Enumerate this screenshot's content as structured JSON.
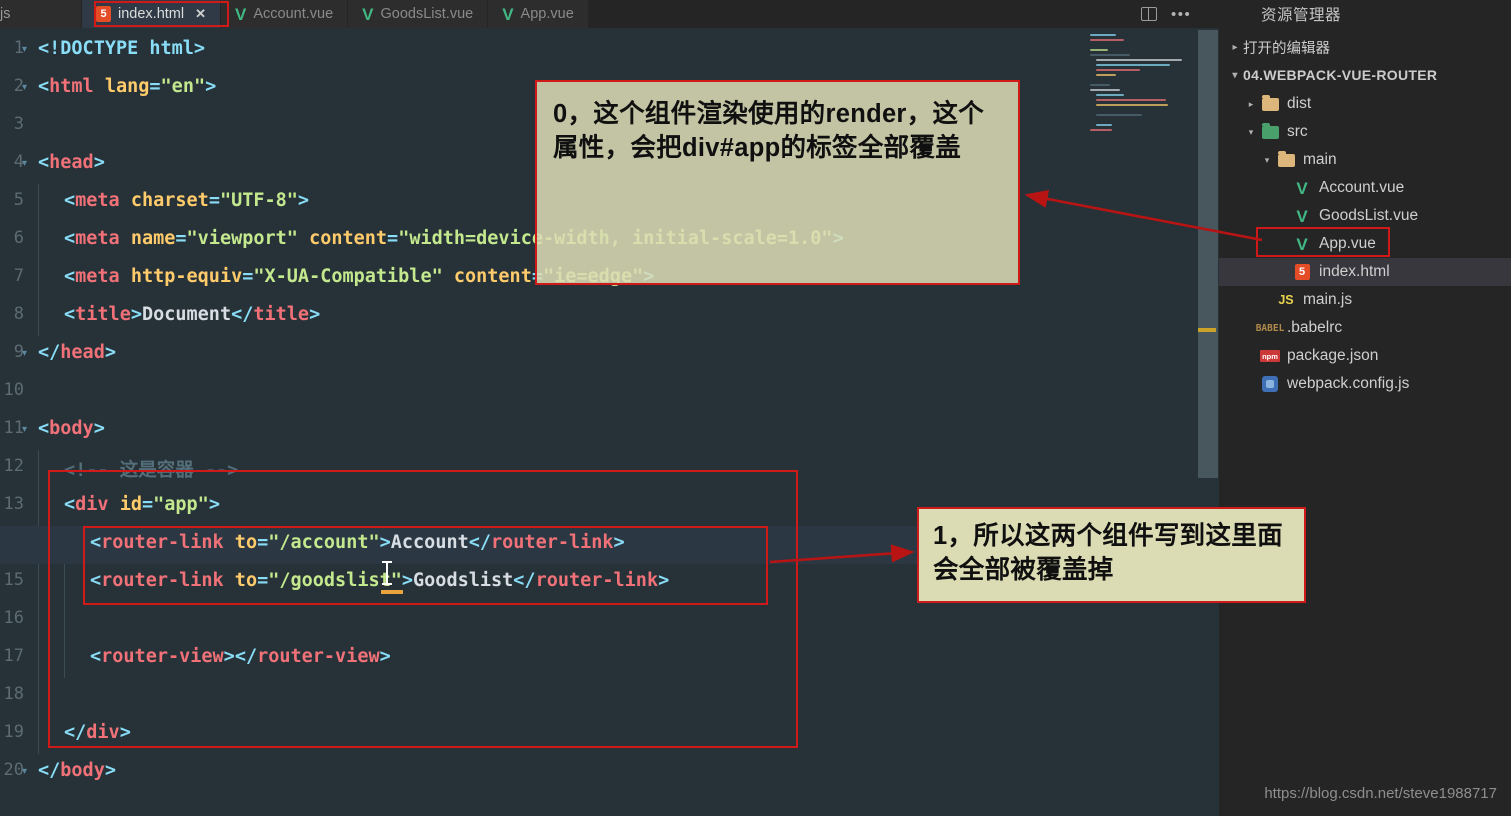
{
  "window": {
    "app": "Visual Studio Code",
    "watermark": "https://blog.csdn.net/steve1988717"
  },
  "tabbar": {
    "tabs": [
      {
        "label": ".js",
        "icon": "js-icon",
        "active": false,
        "partial": true
      },
      {
        "label": "index.html",
        "icon": "html5-icon",
        "active": true,
        "close": "✕",
        "highlighted": true
      },
      {
        "label": "Account.vue",
        "icon": "vue-icon",
        "active": false
      },
      {
        "label": "GoodsList.vue",
        "icon": "vue-icon",
        "active": false
      },
      {
        "label": "App.vue",
        "icon": "vue-icon",
        "active": false
      }
    ],
    "actions": [
      {
        "name": "split-editor-icon",
        "label": ""
      },
      {
        "name": "more-actions-icon",
        "label": "•••"
      }
    ]
  },
  "editor": {
    "file": "index.html",
    "language": "html",
    "lines": [
      {
        "n": "1",
        "fold": "▾",
        "segs": [
          {
            "t": "<!DOCTYPE html>",
            "c": "t-doctype"
          }
        ]
      },
      {
        "n": "2",
        "fold": "▾",
        "segs": [
          {
            "t": "<",
            "c": "t-punc"
          },
          {
            "t": "html",
            "c": "t-tag"
          },
          {
            "t": " lang",
            "c": "t-attr"
          },
          {
            "t": "=",
            "c": "t-punc"
          },
          {
            "t": "\"en\"",
            "c": "t-str"
          },
          {
            "t": ">",
            "c": "t-punc"
          }
        ]
      },
      {
        "n": "3",
        "fold": "",
        "segs": []
      },
      {
        "n": "4",
        "fold": "▾",
        "segs": [
          {
            "t": "<",
            "c": "t-punc"
          },
          {
            "t": "head",
            "c": "t-tag"
          },
          {
            "t": ">",
            "c": "t-punc"
          }
        ]
      },
      {
        "n": "5",
        "fold": "",
        "indent": 1,
        "segs": [
          {
            "t": "<",
            "c": "t-punc"
          },
          {
            "t": "meta",
            "c": "t-tag"
          },
          {
            "t": " charset",
            "c": "t-attr"
          },
          {
            "t": "=",
            "c": "t-punc"
          },
          {
            "t": "\"UTF-8\"",
            "c": "t-str"
          },
          {
            "t": ">",
            "c": "t-punc"
          }
        ]
      },
      {
        "n": "6",
        "fold": "",
        "indent": 1,
        "segs": [
          {
            "t": "<",
            "c": "t-punc"
          },
          {
            "t": "meta",
            "c": "t-tag"
          },
          {
            "t": " name",
            "c": "t-attr"
          },
          {
            "t": "=",
            "c": "t-punc"
          },
          {
            "t": "\"viewport\"",
            "c": "t-str"
          },
          {
            "t": " content",
            "c": "t-attr"
          },
          {
            "t": "=",
            "c": "t-punc"
          },
          {
            "t": "\"width=device-width, initial-scale=1.0\"",
            "c": "t-str"
          },
          {
            "t": ">",
            "c": "t-punc"
          }
        ]
      },
      {
        "n": "7",
        "fold": "",
        "indent": 1,
        "segs": [
          {
            "t": "<",
            "c": "t-punc"
          },
          {
            "t": "meta",
            "c": "t-tag"
          },
          {
            "t": " http-equiv",
            "c": "t-attr"
          },
          {
            "t": "=",
            "c": "t-punc"
          },
          {
            "t": "\"X-UA-Compatible\"",
            "c": "t-str"
          },
          {
            "t": " content",
            "c": "t-attr"
          },
          {
            "t": "=",
            "c": "t-punc"
          },
          {
            "t": "\"ie=edge\"",
            "c": "t-str"
          },
          {
            "t": ">",
            "c": "t-punc"
          }
        ]
      },
      {
        "n": "8",
        "fold": "",
        "indent": 1,
        "segs": [
          {
            "t": "<",
            "c": "t-punc"
          },
          {
            "t": "title",
            "c": "t-tag"
          },
          {
            "t": ">",
            "c": "t-punc"
          },
          {
            "t": "Document",
            "c": "t-txt"
          },
          {
            "t": "</",
            "c": "t-punc"
          },
          {
            "t": "title",
            "c": "t-tag"
          },
          {
            "t": ">",
            "c": "t-punc"
          }
        ]
      },
      {
        "n": "9",
        "fold": "▾",
        "segs": [
          {
            "t": "</",
            "c": "t-punc"
          },
          {
            "t": "head",
            "c": "t-tag"
          },
          {
            "t": ">",
            "c": "t-punc"
          }
        ]
      },
      {
        "n": "10",
        "fold": "",
        "segs": []
      },
      {
        "n": "11",
        "fold": "▾",
        "segs": [
          {
            "t": "<",
            "c": "t-punc"
          },
          {
            "t": "body",
            "c": "t-tag"
          },
          {
            "t": ">",
            "c": "t-punc"
          }
        ]
      },
      {
        "n": "12",
        "fold": "",
        "indent": 1,
        "segs": [
          {
            "t": "<!-- 这是容器 -->",
            "c": "t-comment"
          }
        ]
      },
      {
        "n": "13",
        "fold": "",
        "indent": 1,
        "segs": [
          {
            "t": "<",
            "c": "t-punc"
          },
          {
            "t": "div",
            "c": "t-tag"
          },
          {
            "t": " id",
            "c": "t-attr"
          },
          {
            "t": "=",
            "c": "t-punc"
          },
          {
            "t": "\"app\"",
            "c": "t-str"
          },
          {
            "t": ">",
            "c": "t-punc"
          }
        ]
      },
      {
        "n": "14",
        "fold": "",
        "indent": 2,
        "highlight": true,
        "segs": [
          {
            "t": "<",
            "c": "t-punc"
          },
          {
            "t": "router-link",
            "c": "t-tag"
          },
          {
            "t": " to",
            "c": "t-attr"
          },
          {
            "t": "=",
            "c": "t-punc"
          },
          {
            "t": "\"/account\"",
            "c": "t-str"
          },
          {
            "t": ">",
            "c": "t-punc"
          },
          {
            "t": "Account",
            "c": "t-txt"
          },
          {
            "t": "</",
            "c": "t-punc"
          },
          {
            "t": "router-link",
            "c": "t-tag"
          },
          {
            "t": ">",
            "c": "t-punc"
          }
        ]
      },
      {
        "n": "15",
        "fold": "",
        "indent": 2,
        "segs": [
          {
            "t": "<",
            "c": "t-punc"
          },
          {
            "t": "router-link",
            "c": "t-tag"
          },
          {
            "t": " to",
            "c": "t-attr"
          },
          {
            "t": "=",
            "c": "t-punc"
          },
          {
            "t": "\"/goodslist\"",
            "c": "t-str"
          },
          {
            "t": ">",
            "c": "t-punc"
          },
          {
            "t": "Goodslist",
            "c": "t-txt"
          },
          {
            "t": "</",
            "c": "t-punc"
          },
          {
            "t": "router-link",
            "c": "t-tag"
          },
          {
            "t": ">",
            "c": "t-punc"
          }
        ]
      },
      {
        "n": "16",
        "fold": "",
        "indent": 2,
        "segs": []
      },
      {
        "n": "17",
        "fold": "",
        "indent": 2,
        "segs": [
          {
            "t": "<",
            "c": "t-punc"
          },
          {
            "t": "router-view",
            "c": "t-tag"
          },
          {
            "t": ">",
            "c": "t-punc"
          },
          {
            "t": "</",
            "c": "t-punc"
          },
          {
            "t": "router-view",
            "c": "t-tag"
          },
          {
            "t": ">",
            "c": "t-punc"
          }
        ]
      },
      {
        "n": "18",
        "fold": "",
        "indent": 1,
        "segs": []
      },
      {
        "n": "19",
        "fold": "",
        "indent": 1,
        "segs": [
          {
            "t": "</",
            "c": "t-punc"
          },
          {
            "t": "div",
            "c": "t-tag"
          },
          {
            "t": ">",
            "c": "t-punc"
          }
        ]
      },
      {
        "n": "20",
        "fold": "▾",
        "segs": [
          {
            "t": "</",
            "c": "t-punc"
          },
          {
            "t": "body",
            "c": "t-tag"
          },
          {
            "t": ">",
            "c": "t-punc"
          }
        ]
      }
    ]
  },
  "sidebar": {
    "title": "资源管理器",
    "open_editors": {
      "label": "打开的编辑器",
      "twisty": "▸"
    },
    "project": {
      "label": "04.WEBPACK-VUE-ROUTER",
      "twisty": "▾"
    },
    "tree": [
      {
        "label": "dist",
        "icon": "folder-yellow-icon",
        "twisty": "▸",
        "depth": 1,
        "selected": false
      },
      {
        "label": "src",
        "icon": "folder-green-icon",
        "twisty": "▾",
        "depth": 1,
        "selected": false
      },
      {
        "label": "main",
        "icon": "folder-yellow-icon",
        "twisty": "▾",
        "depth": 2,
        "selected": false
      },
      {
        "label": "Account.vue",
        "icon": "vue-icon",
        "twisty": "",
        "depth": 3,
        "selected": false
      },
      {
        "label": "GoodsList.vue",
        "icon": "vue-icon",
        "twisty": "",
        "depth": 3,
        "selected": false
      },
      {
        "label": "App.vue",
        "icon": "vue-icon",
        "twisty": "",
        "depth": 3,
        "selected": false,
        "highlighted": true
      },
      {
        "label": "index.html",
        "icon": "html5-icon",
        "twisty": "",
        "depth": 3,
        "selected": true
      },
      {
        "label": "main.js",
        "icon": "js-icon",
        "twisty": "",
        "depth": 2,
        "selected": false
      },
      {
        "label": ".babelrc",
        "icon": "babel-icon",
        "twisty": "",
        "depth": 1,
        "selected": false
      },
      {
        "label": "package.json",
        "icon": "npm-icon",
        "twisty": "",
        "depth": 1,
        "selected": false
      },
      {
        "label": "webpack.config.js",
        "icon": "webpack-icon",
        "twisty": "",
        "depth": 1,
        "selected": false
      }
    ]
  },
  "annotations": [
    {
      "id": "note-0",
      "text": "0，这个组件渲染使用的render，这个属性，会把div#app的标签全部覆盖",
      "points_to": "App.vue in explorer"
    },
    {
      "id": "note-1",
      "text": "1，所以这两个组件写到这里面会全部被覆盖掉",
      "points_to": "router-link lines"
    }
  ],
  "colors": {
    "annotation_bg": "#dcdcb4",
    "annotation_border": "#d01a1a",
    "editor_bg": "#263238",
    "sidebar_bg": "#252526",
    "vue_green": "#41b883",
    "html5_orange": "#e44d26"
  }
}
